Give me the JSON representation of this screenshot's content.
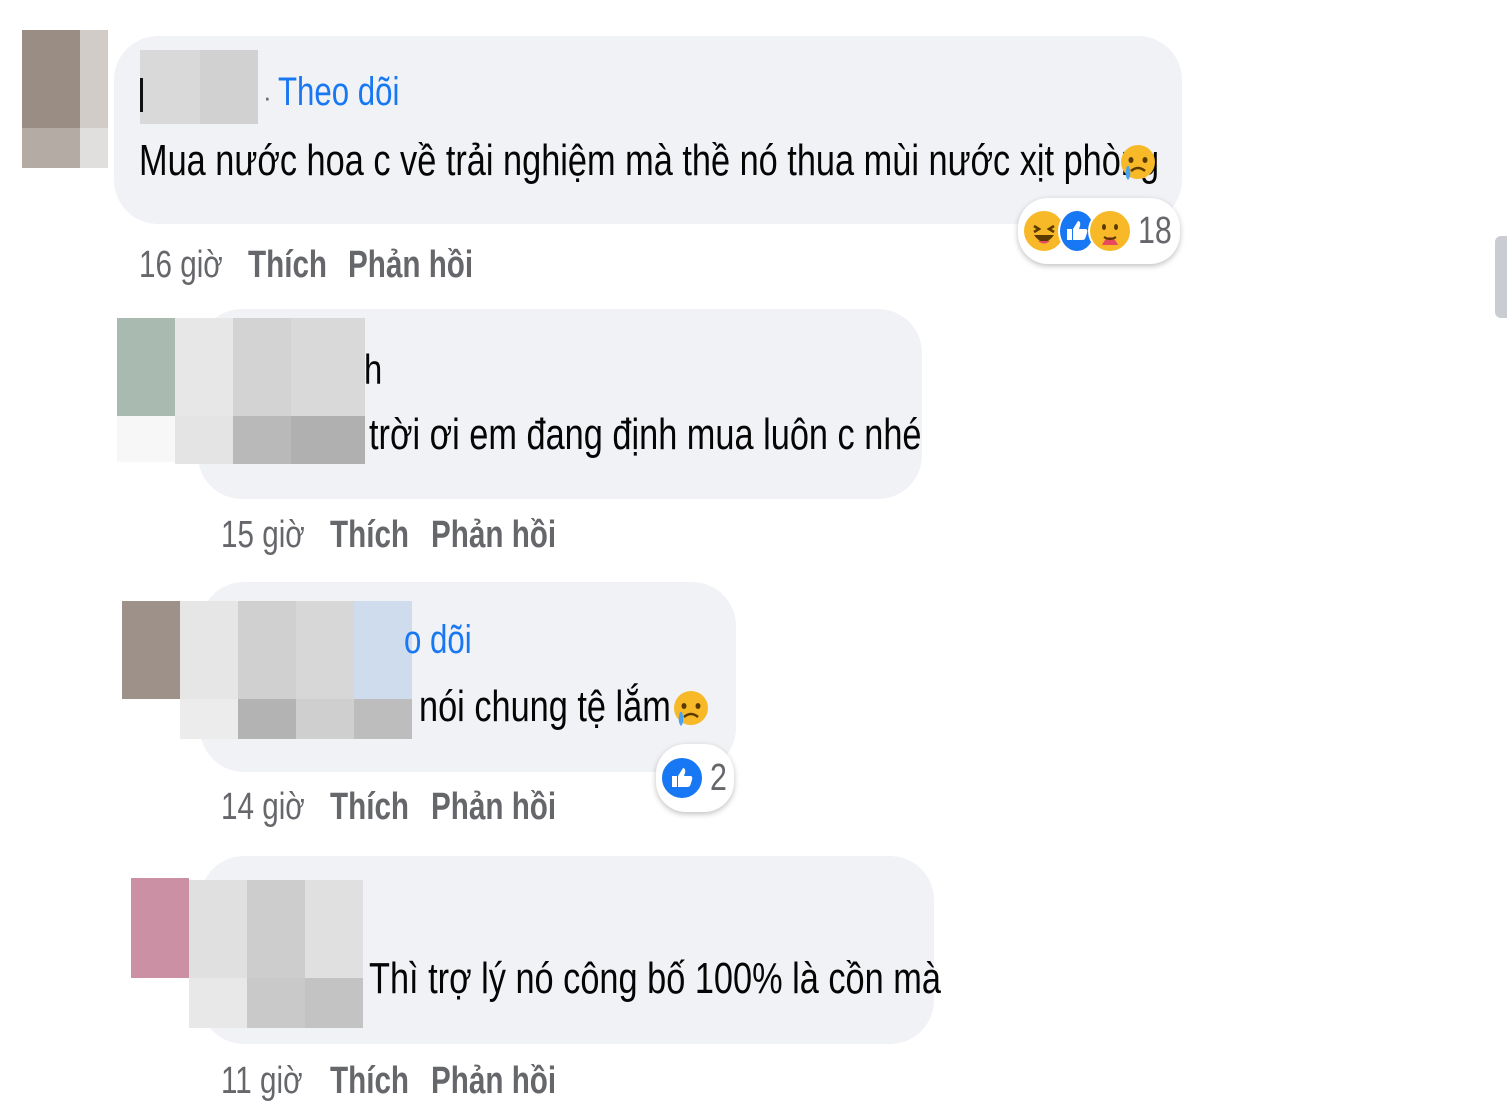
{
  "comments": [
    {
      "follow_label": "Theo dõi",
      "separator": "·",
      "text": "Mua nước hoa c về trải nghiệm mà thề nó thua mùi nước xịt phòng",
      "time": "16 giờ",
      "like_label": "Thích",
      "reply_label": "Phản hồi",
      "reaction_icons": [
        "haha-icon",
        "like-icon",
        "care-icon"
      ],
      "reaction_count": "18"
    },
    {
      "name_fragment": "h",
      "text": "trời ơi em đang định mua luôn c nhé",
      "time": "15 giờ",
      "like_label": "Thích",
      "reply_label": "Phản hồi"
    },
    {
      "follow_label": "o dõi",
      "text": "nói chung tệ lắm",
      "time": "14 giờ",
      "like_label": "Thích",
      "reply_label": "Phản hồi",
      "reaction_icons": [
        "like-icon"
      ],
      "reaction_count": "2"
    },
    {
      "text": "Thì trợ lý nó công bố 100% là cồn mà",
      "time": "11 giờ",
      "like_label": "Thích",
      "reply_label": "Phản hồi"
    }
  ],
  "colors": {
    "bubble": "#f0f2f5",
    "link_blue": "#1877f2",
    "meta_gray": "#65676b",
    "haha_yellow": "#f7b928",
    "like_blue": "#1877f2"
  }
}
